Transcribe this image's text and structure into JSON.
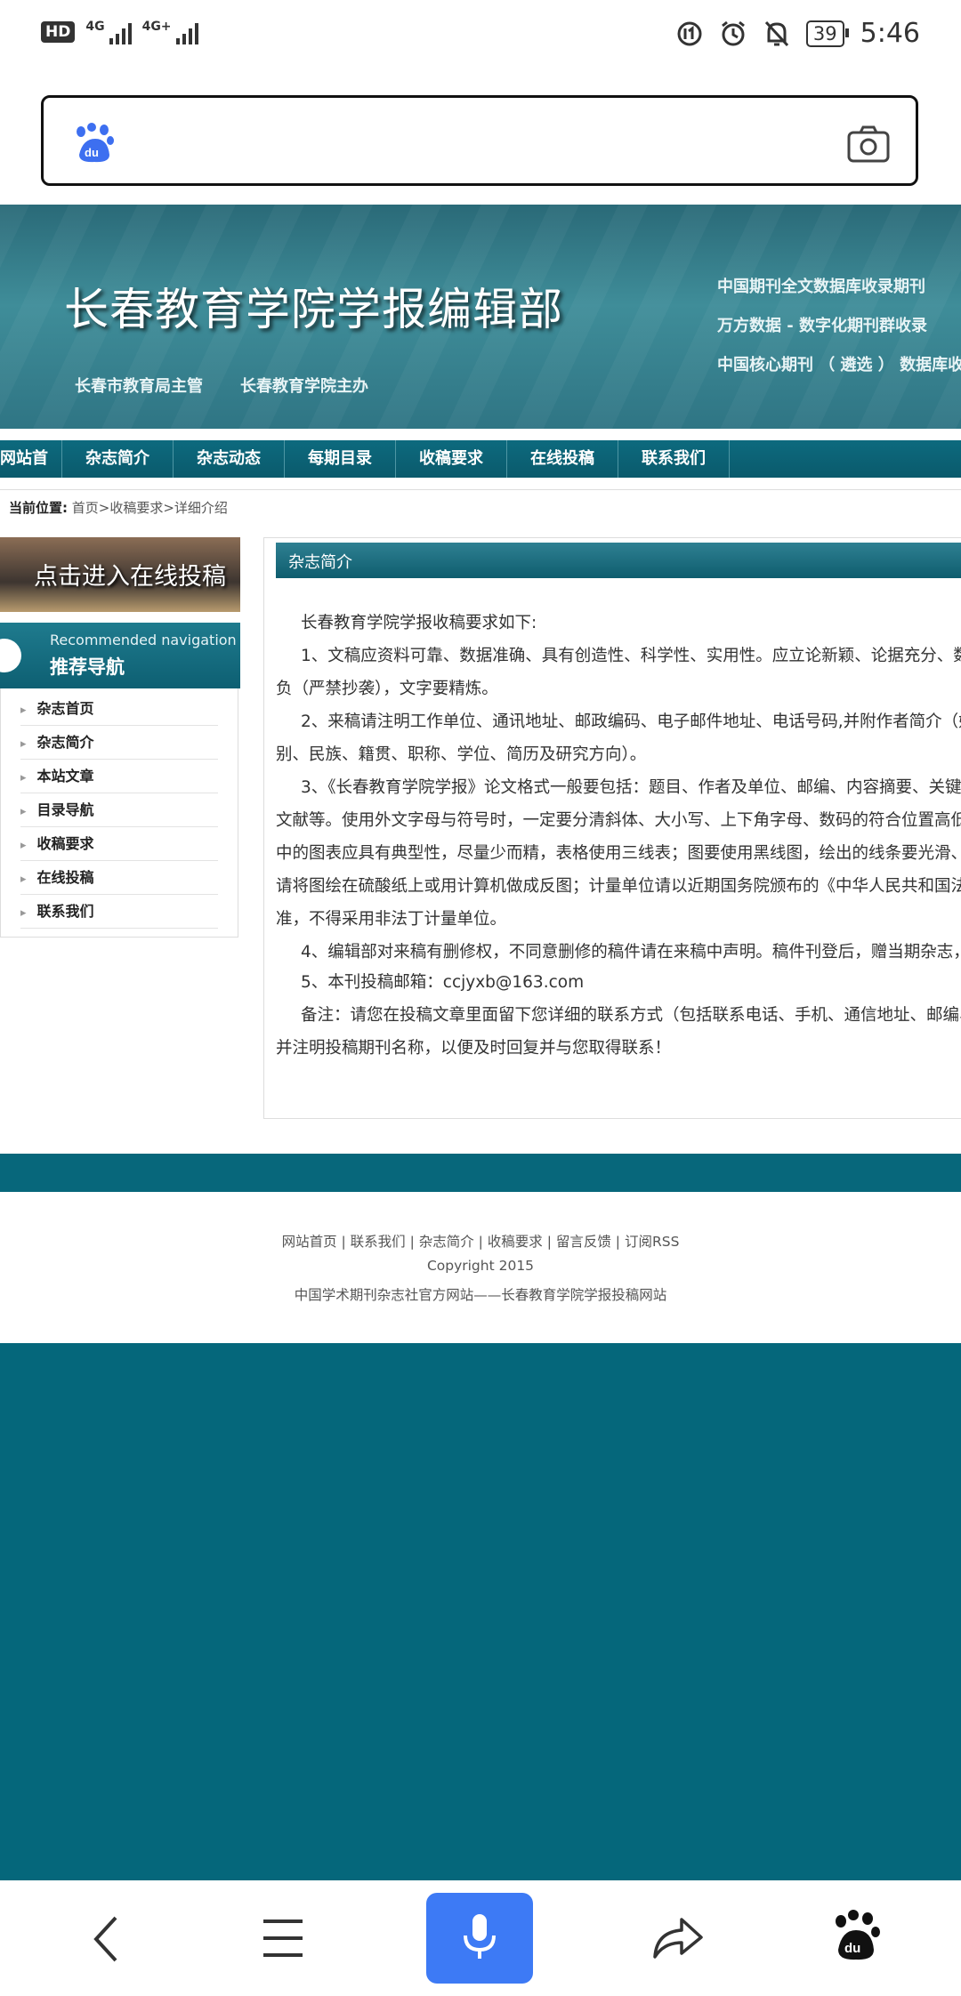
{
  "status_bar": {
    "hd": "HD",
    "sim1": "4G",
    "sim2": "4G+",
    "battery": "39",
    "time": "5:46"
  },
  "search": {
    "placeholder": ""
  },
  "banner": {
    "title": "长春教育学院学报编辑部",
    "sponsor1": "长春市教育局主管",
    "sponsor2": "长春教育学院主办",
    "right_lines": [
      "中国期刊全文数据库收录期刊",
      "万方数据 - 数字化期刊群收录",
      "中国核心期刊 （ 遴选 ） 数据库收"
    ]
  },
  "nav": [
    "网站首页",
    "杂志简介",
    "杂志动态",
    "每期目录",
    "收稿要求",
    "在线投稿",
    "联系我们"
  ],
  "breadcrumb": {
    "label": "当前位置:",
    "path": "首页>收稿要求>详细介绍"
  },
  "sidebar": {
    "promo": "点击进入在线投稿",
    "rec_en": "Recommended navigation",
    "rec_cn": "推荐导航",
    "items": [
      "杂志首页",
      "杂志简介",
      "本站文章",
      "目录导航",
      "收稿要求",
      "在线投稿",
      "联系我们"
    ]
  },
  "content": {
    "heading": "杂志简介",
    "lines": [
      "长春教育学院学报收稿要求如下:",
      "1、文稿应资料可靠、数据准确、具有创造性、科学性、实用性。应立论新颖、论据充分、数",
      "负（严禁抄袭），文字要精炼。",
      "2、来稿请注明工作单位、通讯地址、邮政编码、电子邮件地址、电话号码,并附作者简介（姓",
      "别、民族、籍贯、职称、学位、简历及研究方向）。",
      "3、《长春教育学院学报》论文格式一般要包括：题目、作者及单位、邮编、内容摘要、关键",
      "文献等。使用外文字母与符号时，一定要分清斜体、大小写、上下角字母、数码的符合位置高低",
      "中的图表应具有典型性，尽量少而精，表格使用三线表；图要使用黑线图，绘出的线条要光滑、",
      "请将图绘在硫酸纸上或用计算机做成反图；计量单位请以近期国务院颁布的《中华人民共和国法",
      "准，不得采用非法丁计量单位。",
      "4、编辑部对来稿有删修权，不同意删修的稿件请在来稿中声明。稿件刊登后，赠当期杂志，",
      "5、本刊投稿邮箱：ccjyxb@163.com",
      "备注：请您在投稿文章里面留下您详细的联系方式（包括联系电话、手机、通信地址、邮编、",
      "并注明投稿期刊名称，以便及时回复并与您取得联系！"
    ]
  },
  "footer": {
    "links": "网站首页 | 联系我们 | 杂志简介 | 收稿要求 | 留言反馈 | 订阅RSS",
    "copyright": "Copyright 2015",
    "site": "中国学术期刊杂志社官方网站——长春教育学院学报投稿网站"
  },
  "colors": {
    "teal": "#07677b",
    "accent_blue": "#3d7af5"
  },
  "icons": [
    "baidu-paw-icon",
    "camera-icon",
    "back-icon",
    "menu-icon",
    "microphone-icon",
    "share-icon",
    "baidu-home-icon"
  ]
}
